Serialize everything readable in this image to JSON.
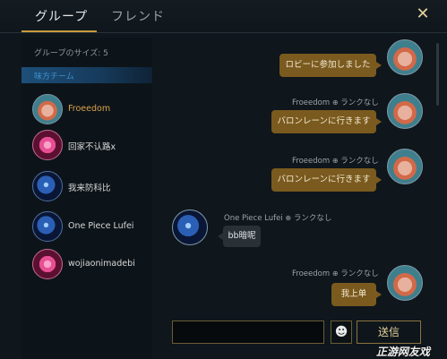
{
  "tabs": {
    "groups": "グループ",
    "friends": "フレンド"
  },
  "sidebar": {
    "group_size": "グループのサイズ: 5",
    "team_header": "味方チーム",
    "members": [
      {
        "name": "Froeedom",
        "highlight": true,
        "avatar": "orange-champion-avatar"
      },
      {
        "name": "回家不认路x",
        "highlight": false,
        "avatar": "pink-heart-avatar"
      },
      {
        "name": "我来防科比",
        "highlight": false,
        "avatar": "blue-champion-avatar"
      },
      {
        "name": "One Piece Lufei",
        "highlight": false,
        "avatar": "blue-champion-avatar"
      },
      {
        "name": "wojiaonimadebi",
        "highlight": false,
        "avatar": "pink-heart-avatar"
      }
    ]
  },
  "chat": {
    "messages": [
      {
        "sender": "",
        "rank": "",
        "text": "ロビーに参加しました",
        "mine": true
      },
      {
        "sender": "Froeedom",
        "rank": "ランクなし",
        "text": "バロンレーンに行きます",
        "mine": true
      },
      {
        "sender": "Froeedom",
        "rank": "ランクなし",
        "text": "バロンレーンに行きます",
        "mine": true
      },
      {
        "sender": "One Piece Lufei",
        "rank": "ランクなし",
        "text": "bb暗呢",
        "mine": false
      },
      {
        "sender": "Froeedom",
        "rank": "ランクなし",
        "text": "我上单",
        "mine": true
      }
    ]
  },
  "composer": {
    "send_label": "送信",
    "input_value": ""
  },
  "watermark": "正游网友戏",
  "colors": {
    "accent_gold": "#c89b3c",
    "bubble_mine": "#7a5a1e",
    "bubble_other": "#2a3136",
    "highlight_name": "#d9a24a",
    "team_blue": "#1d4f7a"
  }
}
